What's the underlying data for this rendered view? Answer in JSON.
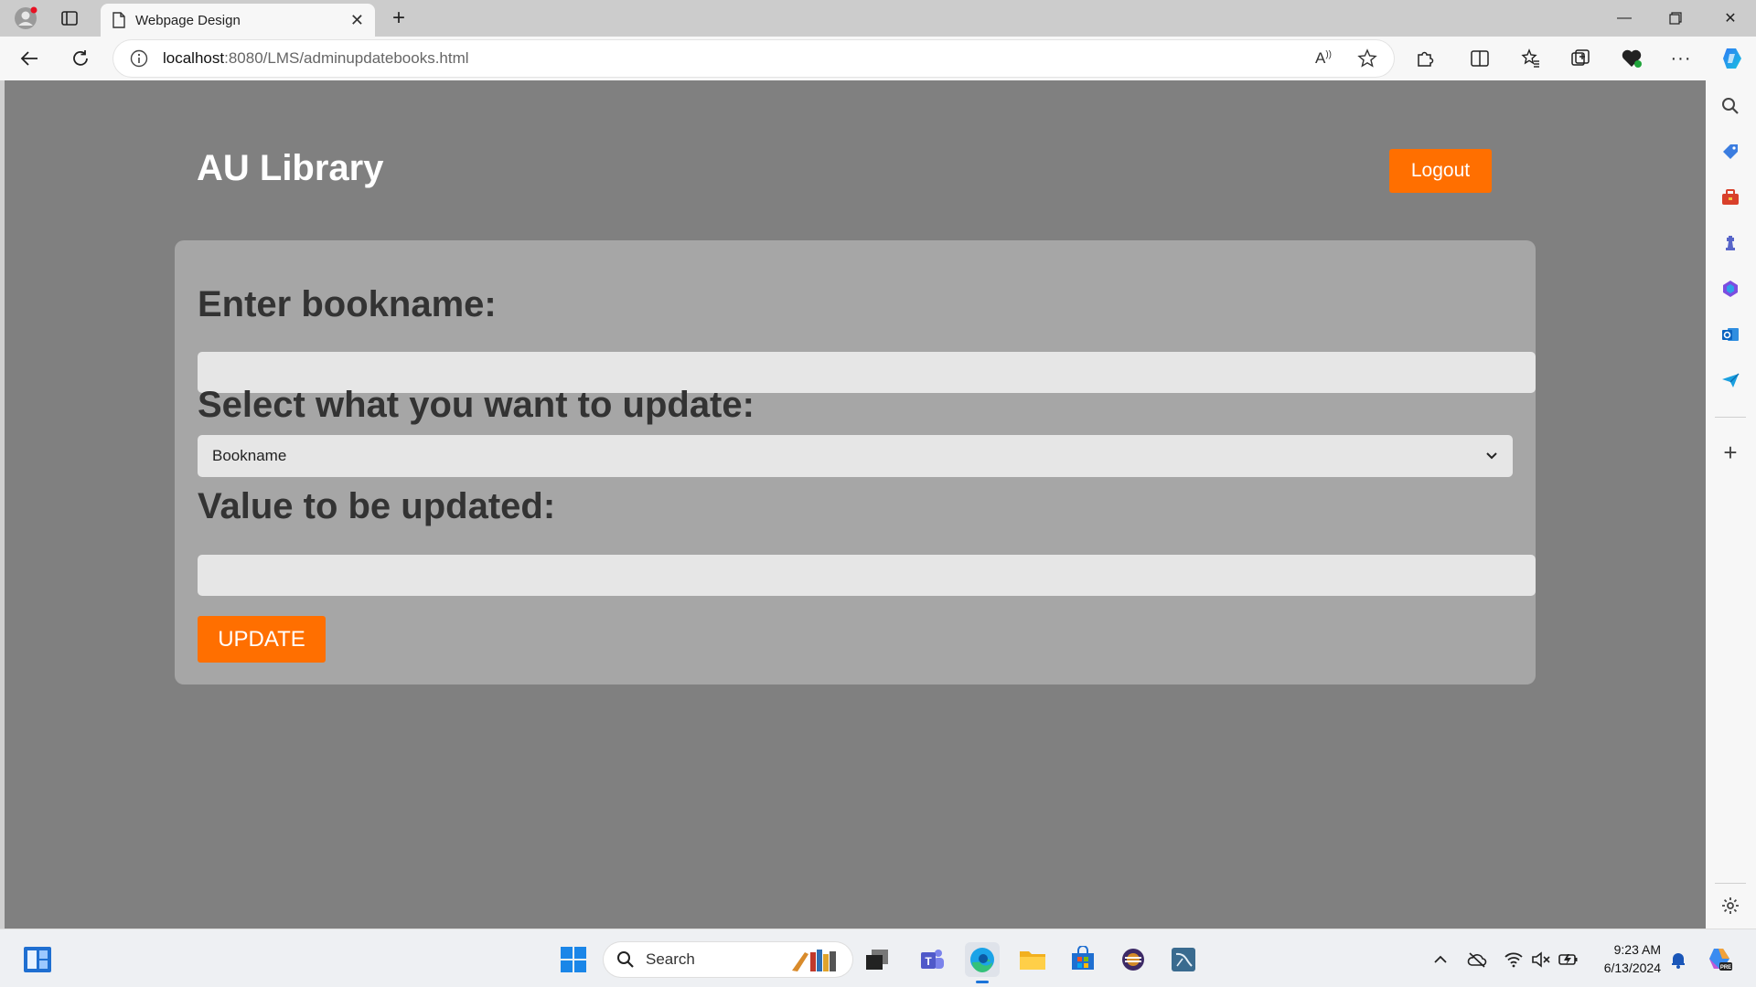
{
  "browser": {
    "tab_title": "Webpage Design",
    "url_host": "localhost",
    "url_path": ":8080/LMS/adminupdatebooks.html"
  },
  "page": {
    "site_title": "AU Library",
    "logout_label": "Logout",
    "form": {
      "bookname_label": "Enter bookname:",
      "bookname_value": "",
      "field_label": "Select what you want to update:",
      "field_selected": "Bookname",
      "value_label": "Value to be updated:",
      "value_value": "",
      "update_label": "UPDATE"
    }
  },
  "taskbar": {
    "search_label": "Search",
    "time": "9:23 AM",
    "date": "6/13/2024"
  },
  "colors": {
    "page_bg": "#808080",
    "card_bg": "#a6a6a6",
    "accent": "#ff6f00"
  },
  "icons": {
    "sidebar": [
      "search-icon",
      "tag-icon",
      "toolbox-icon",
      "chess-icon",
      "copilot-icon",
      "outlook-icon",
      "send-icon",
      "add-icon",
      "settings-icon"
    ]
  }
}
